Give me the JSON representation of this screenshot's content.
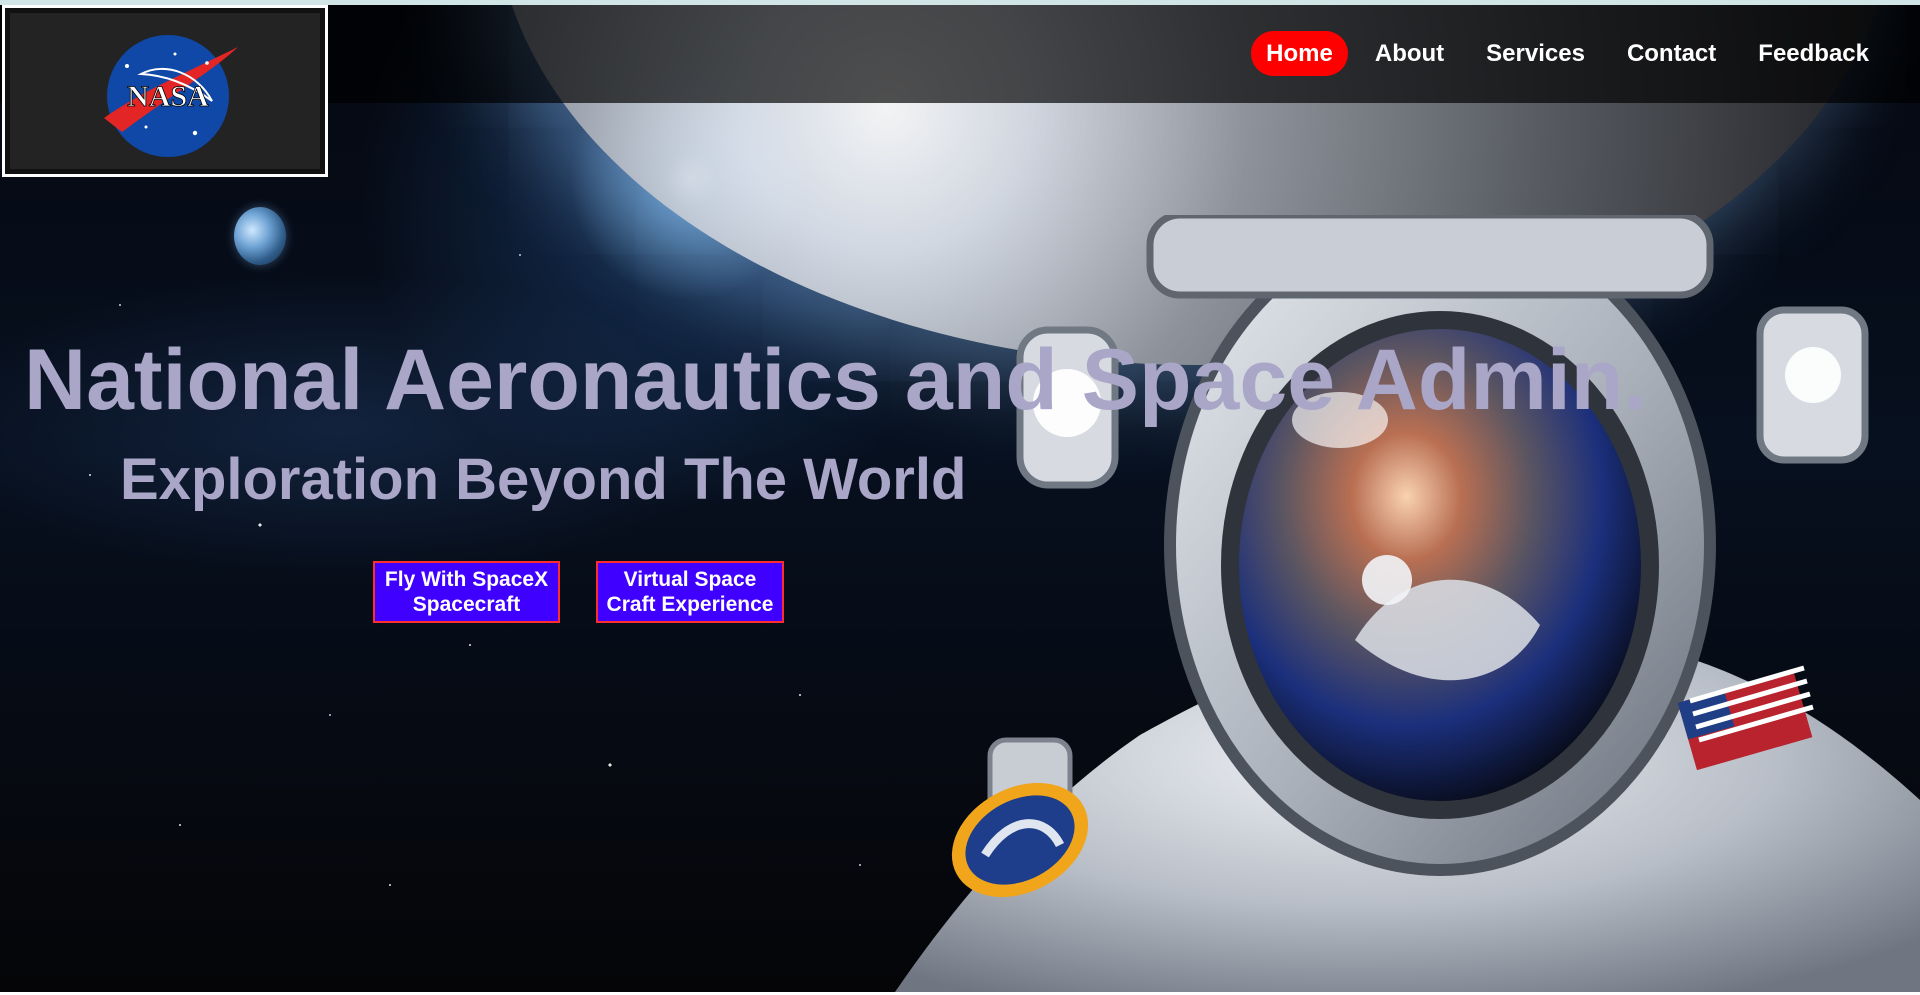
{
  "brand": {
    "logo_text": "NASA"
  },
  "nav": {
    "items": [
      {
        "label": "Home",
        "active": true
      },
      {
        "label": "About",
        "active": false
      },
      {
        "label": "Services",
        "active": false
      },
      {
        "label": "Contact",
        "active": false
      },
      {
        "label": "Feedback",
        "active": false
      }
    ]
  },
  "hero": {
    "title": "National Aeronautics and Space Admin.",
    "subtitle": "Exploration Beyond The World",
    "buttons": [
      {
        "line1": "Fly With SpaceX",
        "line2": "Spacecraft"
      },
      {
        "line1": "Virtual Space",
        "line2": "Craft Experience"
      }
    ]
  },
  "colors": {
    "active_nav": "#ff0000",
    "cta_background": "#3f00ff",
    "cta_border": "#ff2d2d",
    "title_text": "#aaa6c8"
  },
  "icons": {
    "logo": "nasa-logo-icon",
    "earth": "earth-icon",
    "astronaut": "astronaut-image"
  }
}
